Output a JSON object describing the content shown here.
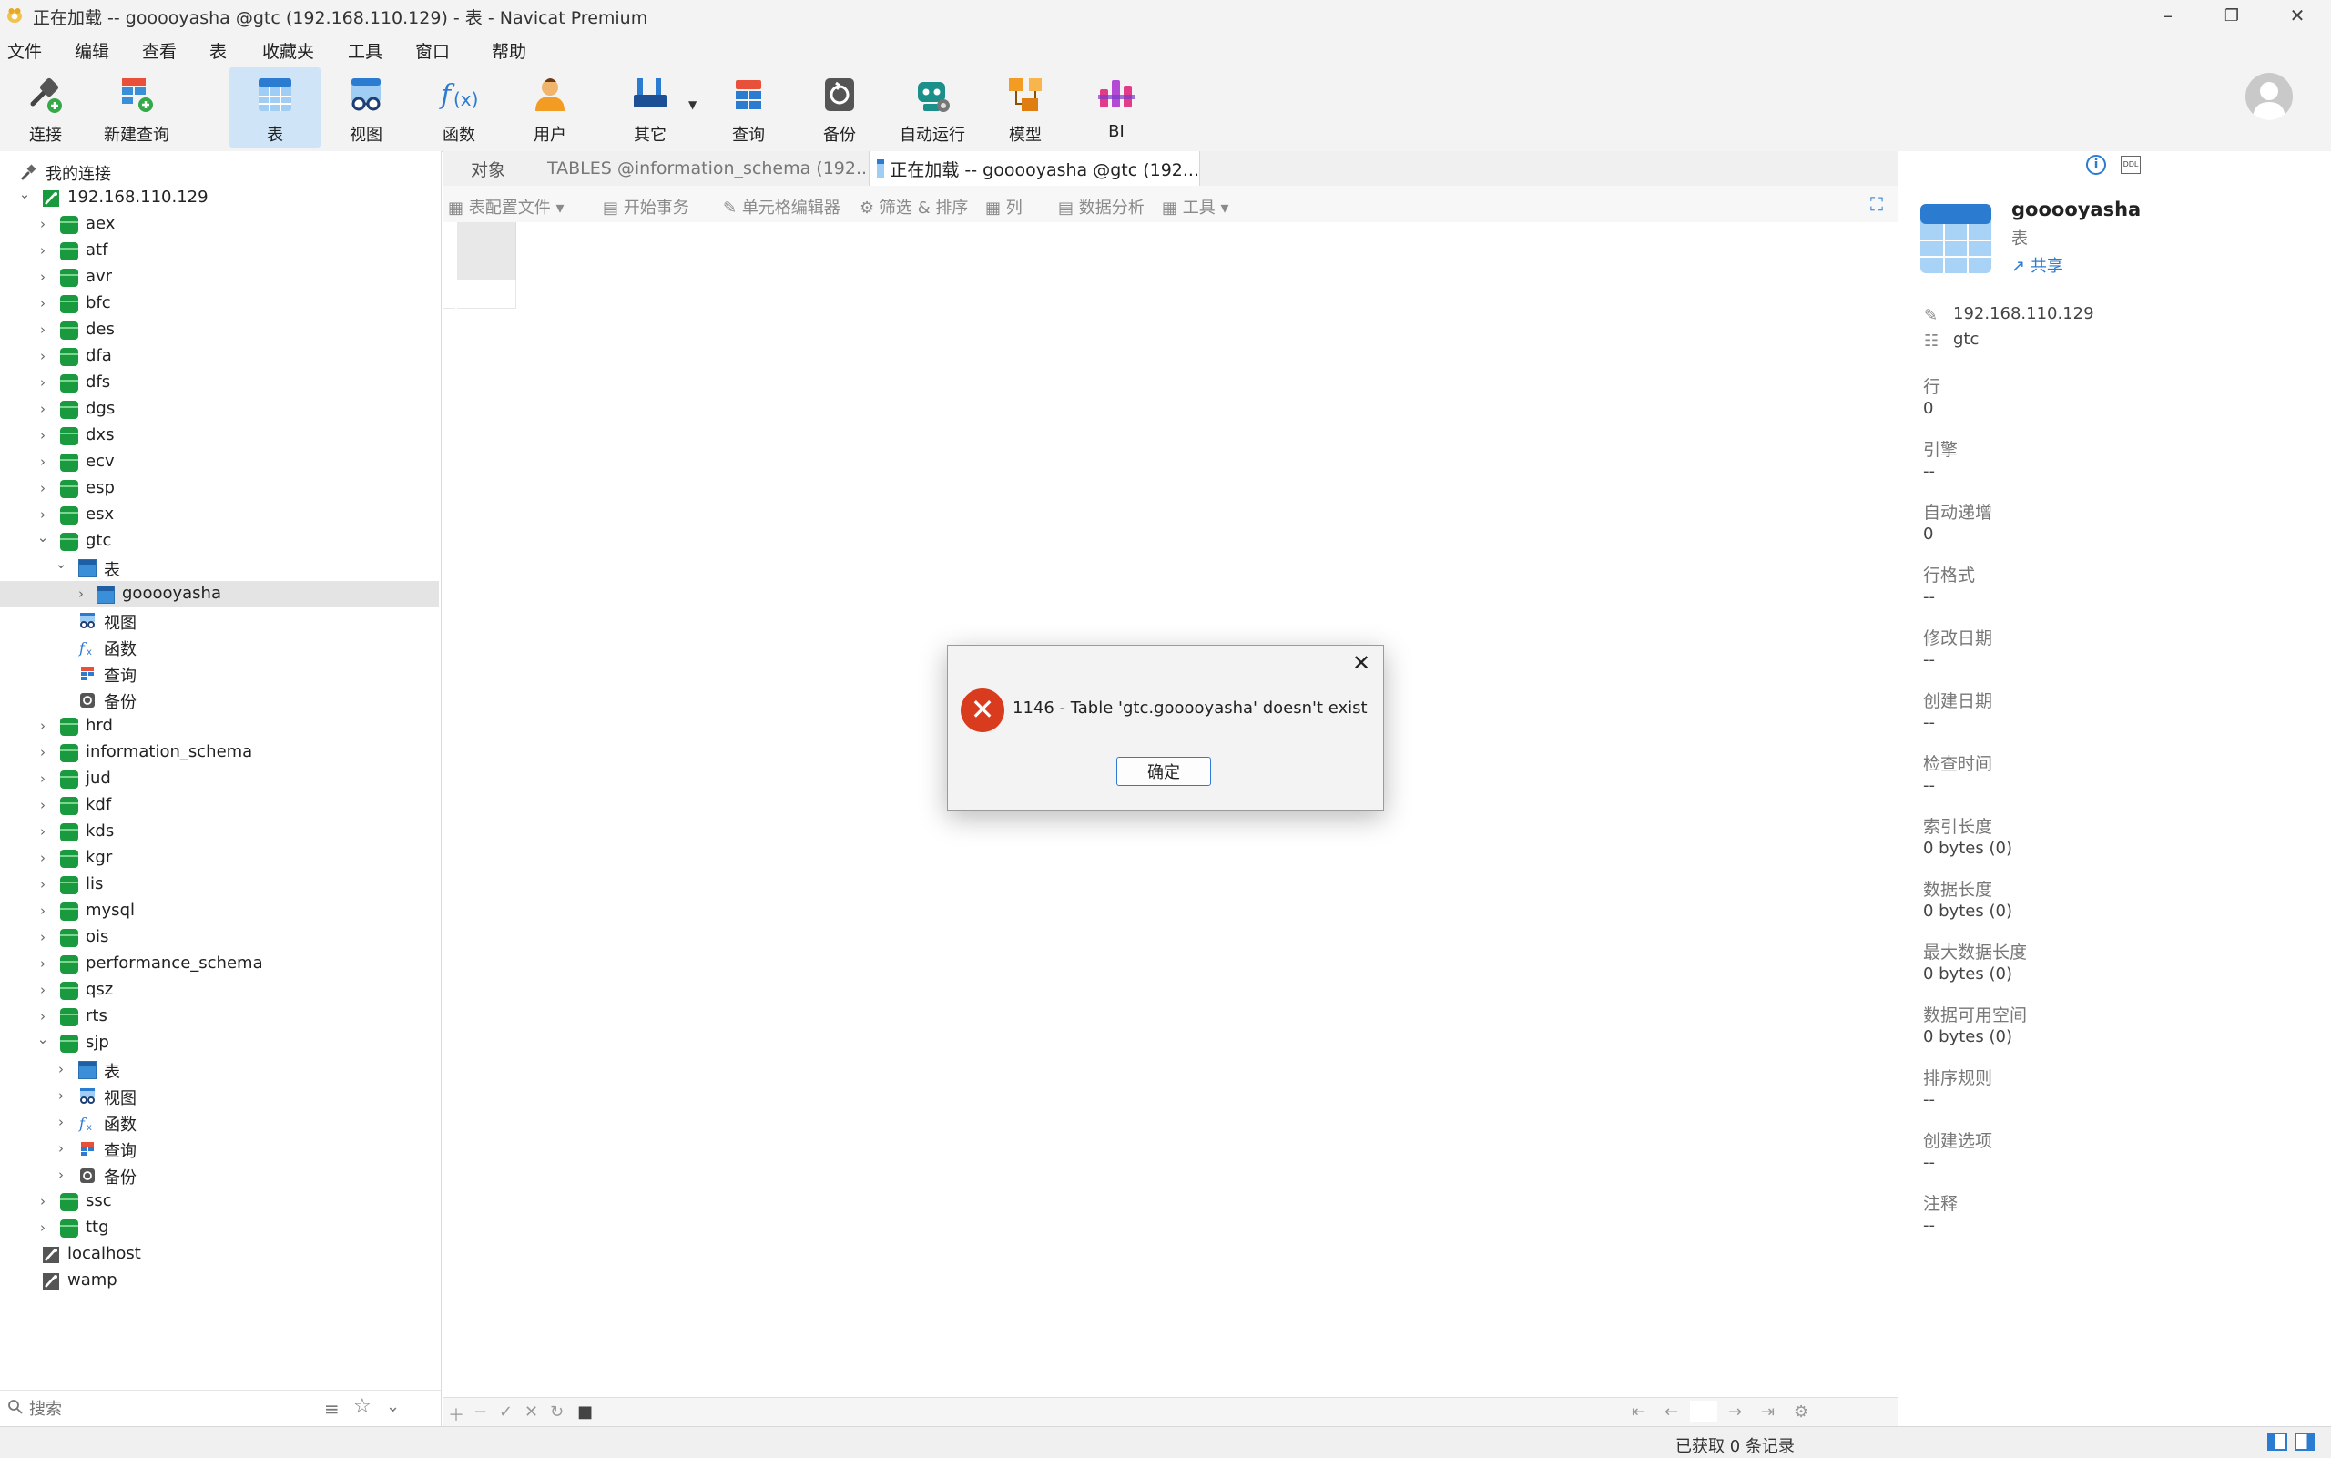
{
  "window": {
    "title": "正在加载 -- gooooyasha @gtc (192.168.110.129) - 表 - Navicat Premium"
  },
  "menu": [
    "文件",
    "编辑",
    "查看",
    "表",
    "收藏夹",
    "工具",
    "窗口",
    "帮助"
  ],
  "toolbar": {
    "items": [
      {
        "label": "连接",
        "icon": "plug-icon"
      },
      {
        "label": "新建查询",
        "icon": "new-query-icon"
      },
      {
        "label": "表",
        "icon": "table-icon",
        "active": true
      },
      {
        "label": "视图",
        "icon": "view-icon"
      },
      {
        "label": "函数",
        "icon": "function-icon"
      },
      {
        "label": "用户",
        "icon": "user-icon"
      },
      {
        "label": "其它",
        "icon": "tools-icon"
      },
      {
        "label": "查询",
        "icon": "query-icon"
      },
      {
        "label": "备份",
        "icon": "backup-icon"
      },
      {
        "label": "自动运行",
        "icon": "robot-icon"
      },
      {
        "label": "模型",
        "icon": "model-icon"
      },
      {
        "label": "BI",
        "icon": "bi-icon"
      }
    ]
  },
  "sidebar": {
    "header": "我的连接",
    "connection": "192.168.110.129",
    "dbs_top": [
      "aex",
      "atf",
      "avr",
      "bfc",
      "des",
      "dfa",
      "dfs",
      "dgs",
      "dxs",
      "ecv",
      "esp",
      "esx"
    ],
    "gtc": {
      "name": "gtc",
      "children": [
        "表",
        "gooooyasha",
        "视图",
        "函数",
        "查询",
        "备份"
      ]
    },
    "dbs_mid": [
      "hrd",
      "information_schema",
      "jud",
      "kdf",
      "kds",
      "kgr",
      "lis",
      "mysql",
      "ois",
      "performance_schema",
      "qsz",
      "rts"
    ],
    "sjp": {
      "name": "sjp",
      "children": [
        "表",
        "视图",
        "函数",
        "查询",
        "备份"
      ]
    },
    "dbs_bottom": [
      "ssc",
      "ttg"
    ],
    "other_connections": [
      "localhost",
      "wamp"
    ],
    "search_placeholder": "搜索"
  },
  "tabs": [
    {
      "label": "对象"
    },
    {
      "label": "TABLES @information_schema (192...."
    },
    {
      "label": "正在加载 -- gooooyasha @gtc (192..."
    }
  ],
  "object_toolbar": {
    "items": [
      "表配置文件",
      "开始事务",
      "单元格编辑器",
      "筛选 & 排序",
      "列",
      "数据分析",
      "工具"
    ]
  },
  "status": {
    "records": "已获取 0 条记录"
  },
  "info_panel": {
    "name": "gooooyasha",
    "type": "表",
    "share": "共享",
    "host": "192.168.110.129",
    "database": "gtc",
    "fields": [
      {
        "label": "行",
        "value": "0"
      },
      {
        "label": "引擎",
        "value": "--"
      },
      {
        "label": "自动递增",
        "value": "0"
      },
      {
        "label": "行格式",
        "value": "--"
      },
      {
        "label": "修改日期",
        "value": "--"
      },
      {
        "label": "创建日期",
        "value": "--"
      },
      {
        "label": "检查时间",
        "value": "--"
      },
      {
        "label": "索引长度",
        "value": "0 bytes (0)"
      },
      {
        "label": "数据长度",
        "value": "0 bytes (0)"
      },
      {
        "label": "最大数据长度",
        "value": "0 bytes (0)"
      },
      {
        "label": "数据可用空间",
        "value": "0 bytes (0)"
      },
      {
        "label": "排序规则",
        "value": "--"
      },
      {
        "label": "创建选项",
        "value": "--"
      },
      {
        "label": "注释",
        "value": "--"
      }
    ]
  },
  "dialog": {
    "message": "1146 - Table 'gtc.gooooyasha' doesn't exist",
    "ok_label": "确定"
  },
  "colors": {
    "accent": "#2f7ad8",
    "db_green": "#1a9a3e",
    "error_red": "#d83b1e",
    "selection": "#e4e4e4"
  }
}
